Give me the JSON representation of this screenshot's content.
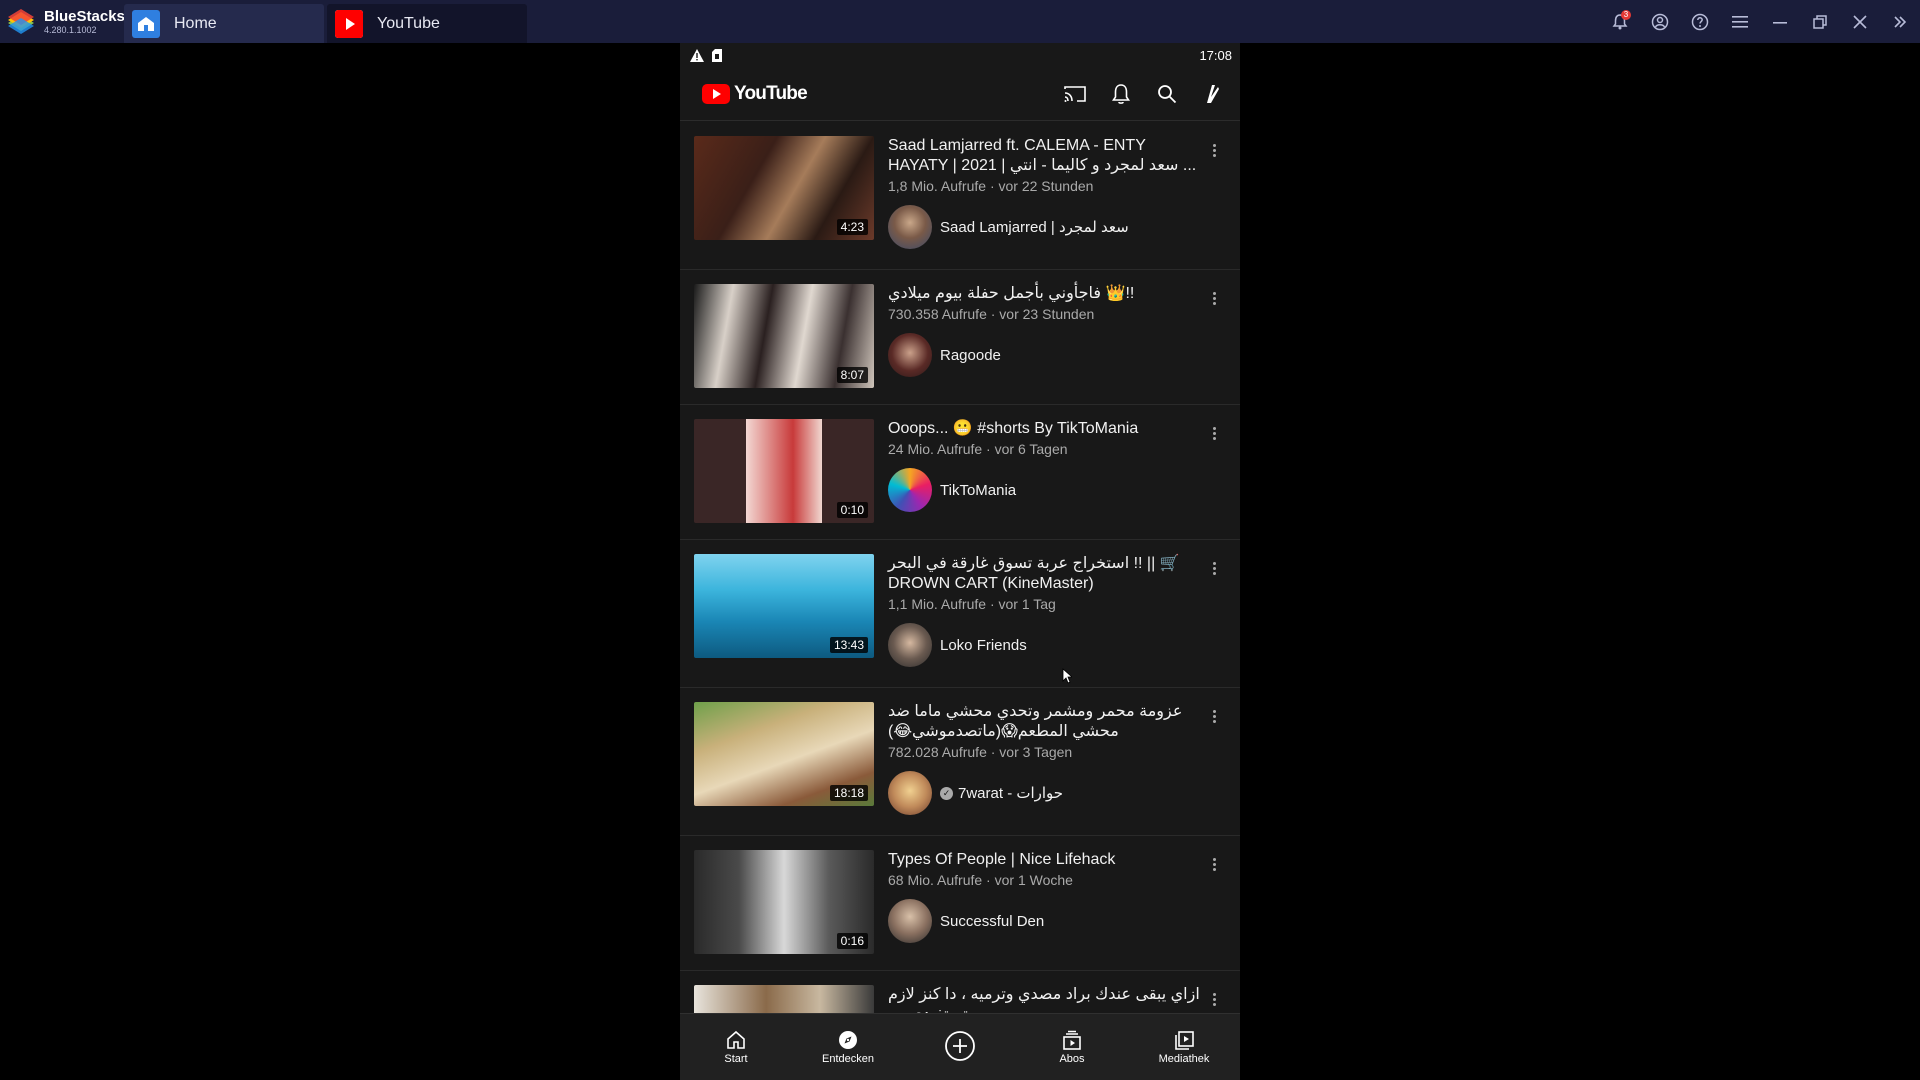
{
  "bluestacks": {
    "brand": "BlueStacks",
    "version": "4.280.1.1002",
    "tabs": [
      {
        "label": "Home"
      },
      {
        "label": "YouTube"
      }
    ],
    "notification_count": "3",
    "colors": {
      "topbar": "#1a1d3a",
      "tab_active": "#12142a",
      "tab_inactive": "#252a4d"
    }
  },
  "phone": {
    "status": {
      "time": "17:08",
      "icons": [
        "warning-icon",
        "sd-card-icon"
      ]
    },
    "header": {
      "logo_text": "YouTube",
      "actions": [
        "cast-icon",
        "bell-icon",
        "search-icon",
        "account-icon"
      ]
    },
    "videos": [
      {
        "title": "Saad Lamjarred ft. CALEMA - ENTY HAYATY | 2021 | سعد لمجرد و كاليما - انتي ...",
        "meta": "1,8 Mio. Aufrufe · vor 22 Stunden",
        "channel": "Saad Lamjarred | سعد لمجرد",
        "duration": "4:23",
        "verified": false
      },
      {
        "title": "فاجأوني بأجمل حفلة بيوم ميلادي 👑!!",
        "meta": "730.358 Aufrufe · vor 23 Stunden",
        "channel": "Ragoode",
        "duration": "8:07",
        "verified": false
      },
      {
        "title": "Ooops... 😬 #shorts By TikToMania",
        "meta": "24 Mio. Aufrufe · vor 6 Tagen",
        "channel": "TikToMania",
        "duration": "0:10",
        "verified": false
      },
      {
        "title": "استخراج عربة تسوق غارقة في البحر !! || 🛒 DROWN CART (KineMaster)",
        "meta": "1,1 Mio. Aufrufe · vor 1 Tag",
        "channel": "Loko Friends",
        "duration": "13:43",
        "verified": false
      },
      {
        "title": "عزومة محمر ومشمر وتحدي محشي ماما ضد محشي المطعم😱(ماتصدموشي😂)",
        "meta": "782.028 Aufrufe · vor 3 Tagen",
        "channel": "7warat - حوارات",
        "duration": "18:18",
        "verified": true
      },
      {
        "title": "Types Of People | Nice Lifehack",
        "meta": "68 Mio. Aufrufe · vor 1 Woche",
        "channel": "Successful Den",
        "duration": "0:16",
        "verified": false
      },
      {
        "title": "ازاي يبقى عندك براد مصدي وترميه ، دا كنز لازم تستفيدي بيه",
        "meta": "",
        "channel": "",
        "duration": "",
        "verified": false
      }
    ],
    "nav": [
      {
        "label": "Start",
        "icon": "home-icon"
      },
      {
        "label": "Entdecken",
        "icon": "explore-icon"
      },
      {
        "label": "",
        "icon": "add-icon"
      },
      {
        "label": "Abos",
        "icon": "subscriptions-icon"
      },
      {
        "label": "Mediathek",
        "icon": "library-icon"
      }
    ],
    "colors": {
      "background": "#181818",
      "brand_red": "#ff0000",
      "text": "#f1f1f1",
      "meta": "#aaaaaa"
    }
  }
}
